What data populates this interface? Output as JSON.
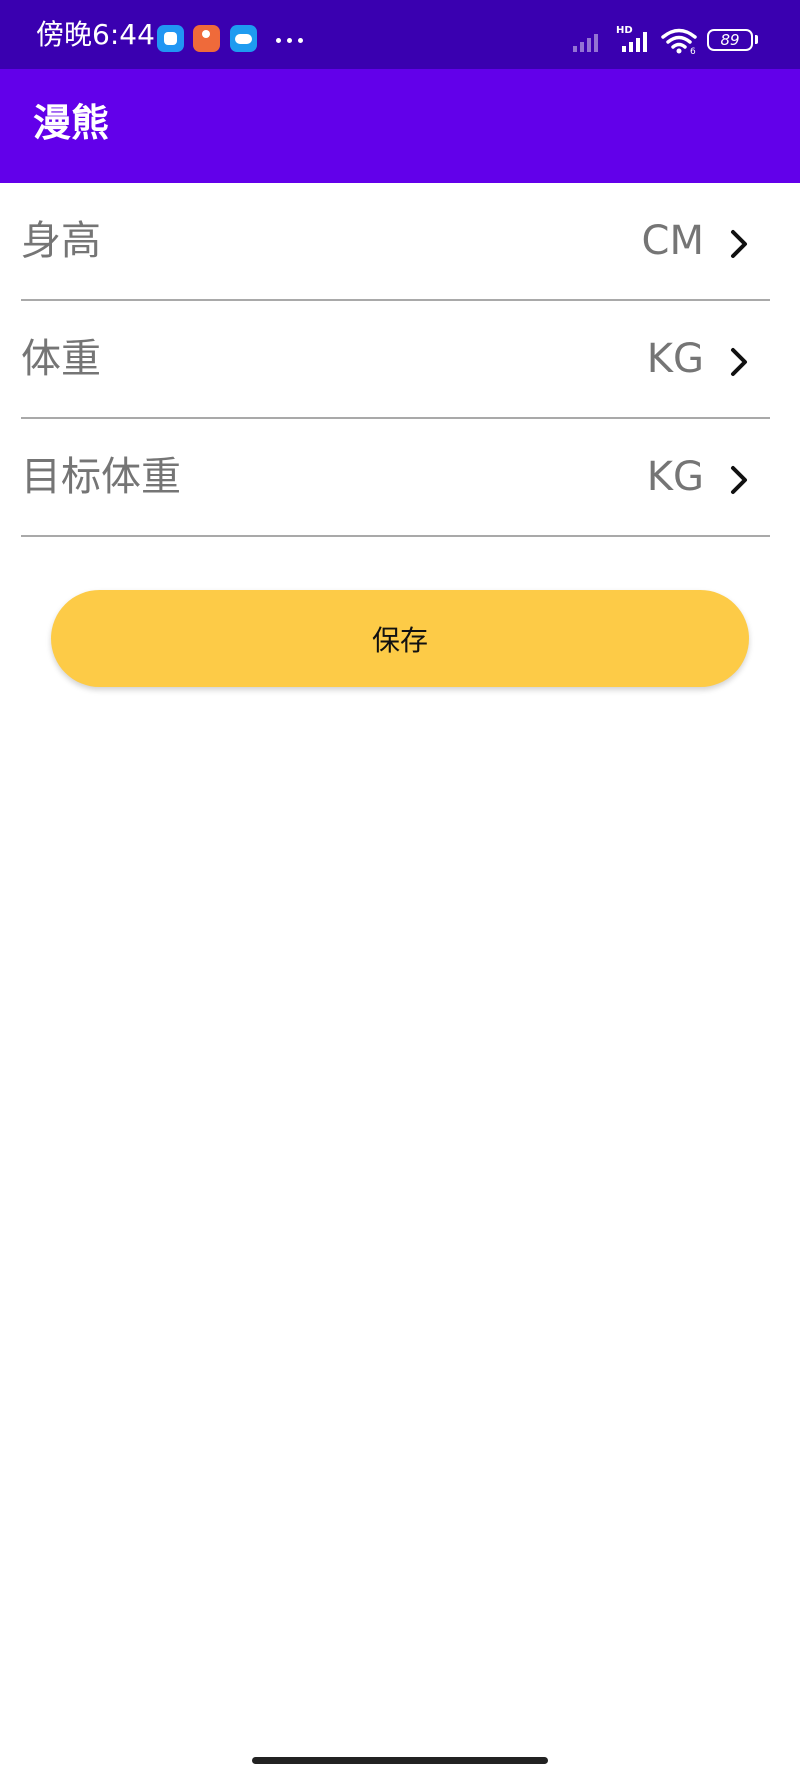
{
  "status_bar": {
    "time": "傍晚6:44",
    "hd_label": "HD",
    "wifi_badge": "6",
    "battery_level": "89",
    "notification_icons": [
      "message-app-icon",
      "fitness-app-icon",
      "cloud-app-icon"
    ],
    "background_color": "#3a00b0"
  },
  "app_bar": {
    "title": "漫熊",
    "background_color": "#6200ea"
  },
  "settings": {
    "rows": [
      {
        "label": "身高",
        "unit": "CM"
      },
      {
        "label": "体重",
        "unit": "KG"
      },
      {
        "label": "目标体重",
        "unit": "KG"
      }
    ]
  },
  "save_button": {
    "label": "保存",
    "background_color": "#fdcb47"
  }
}
